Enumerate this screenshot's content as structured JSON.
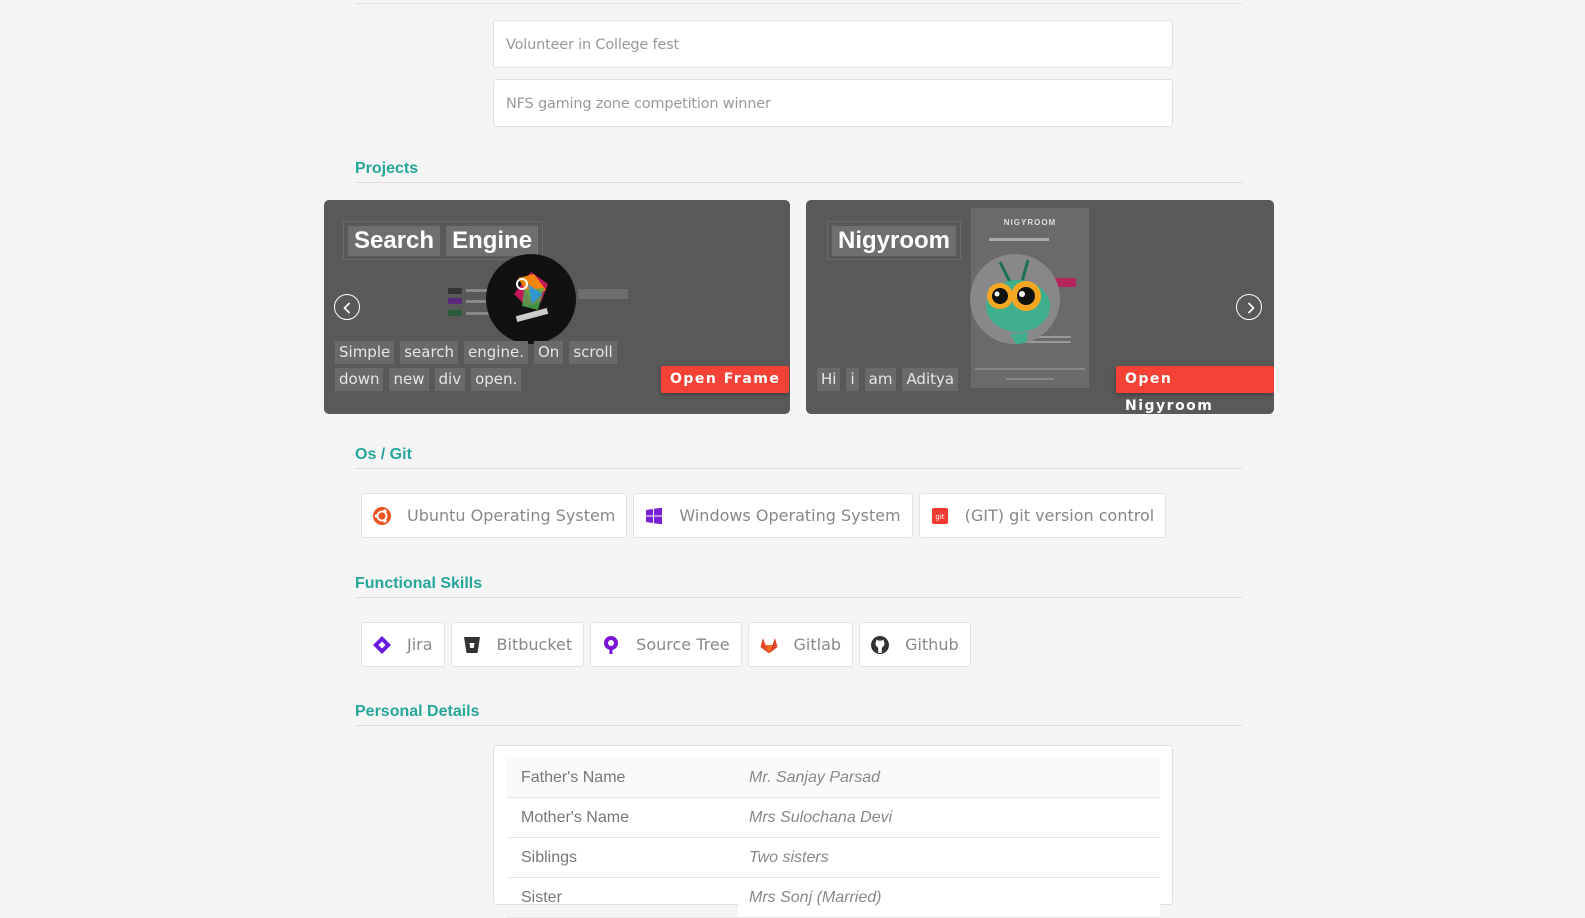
{
  "achievements": [
    "Volunteer in College fest",
    "NFS gaming zone competition winner"
  ],
  "sections": {
    "projects": "Projects",
    "os_git": "Os / Git",
    "functional": "Functional Skills",
    "personal": "Personal Details"
  },
  "projects": [
    {
      "title_words": [
        "Search",
        "Engine"
      ],
      "desc_lines": [
        [
          "Simple",
          "search",
          "engine.",
          "On",
          "scroll"
        ],
        [
          "down",
          "new",
          "div",
          "open."
        ]
      ],
      "button": "Open Frame"
    },
    {
      "title_words": [
        "Nigyroom"
      ],
      "desc_lines": [
        [
          "Hi",
          "i",
          "am",
          "Aditya"
        ]
      ],
      "button": "Open Nigyroom",
      "preview_heading": "NIGYROOM"
    }
  ],
  "os_git": [
    {
      "icon": "ubuntu-icon",
      "label": "Ubuntu Operating System",
      "color": "#e95420"
    },
    {
      "icon": "windows-icon",
      "label": "Windows Operating System",
      "color": "#7a1fd6"
    },
    {
      "icon": "git-icon",
      "label": "(GIT) git version control",
      "color": "#f03c2e"
    }
  ],
  "functional": [
    {
      "icon": "jira-icon",
      "label": "Jira",
      "color": "#6a1be0"
    },
    {
      "icon": "bitbucket-icon",
      "label": "Bitbucket",
      "color": "#333333"
    },
    {
      "icon": "sourcetree-icon",
      "label": "Source Tree",
      "color": "#7b12d8"
    },
    {
      "icon": "gitlab-icon",
      "label": "Gitlab",
      "color": "#e24329"
    },
    {
      "icon": "github-icon",
      "label": "Github",
      "color": "#333333"
    }
  ],
  "personal_details": [
    {
      "key": "Father's Name",
      "value": "Mr. Sanjay Parsad"
    },
    {
      "key": "Mother's Name",
      "value": "Mrs Sulochana Devi"
    },
    {
      "key": "Siblings",
      "value": "Two sisters"
    },
    {
      "key": "Sister",
      "value": "Mrs Sonj (Married)"
    }
  ],
  "colors": {
    "accent": "#26a69a",
    "button": "#f44336",
    "card": "#595959"
  }
}
